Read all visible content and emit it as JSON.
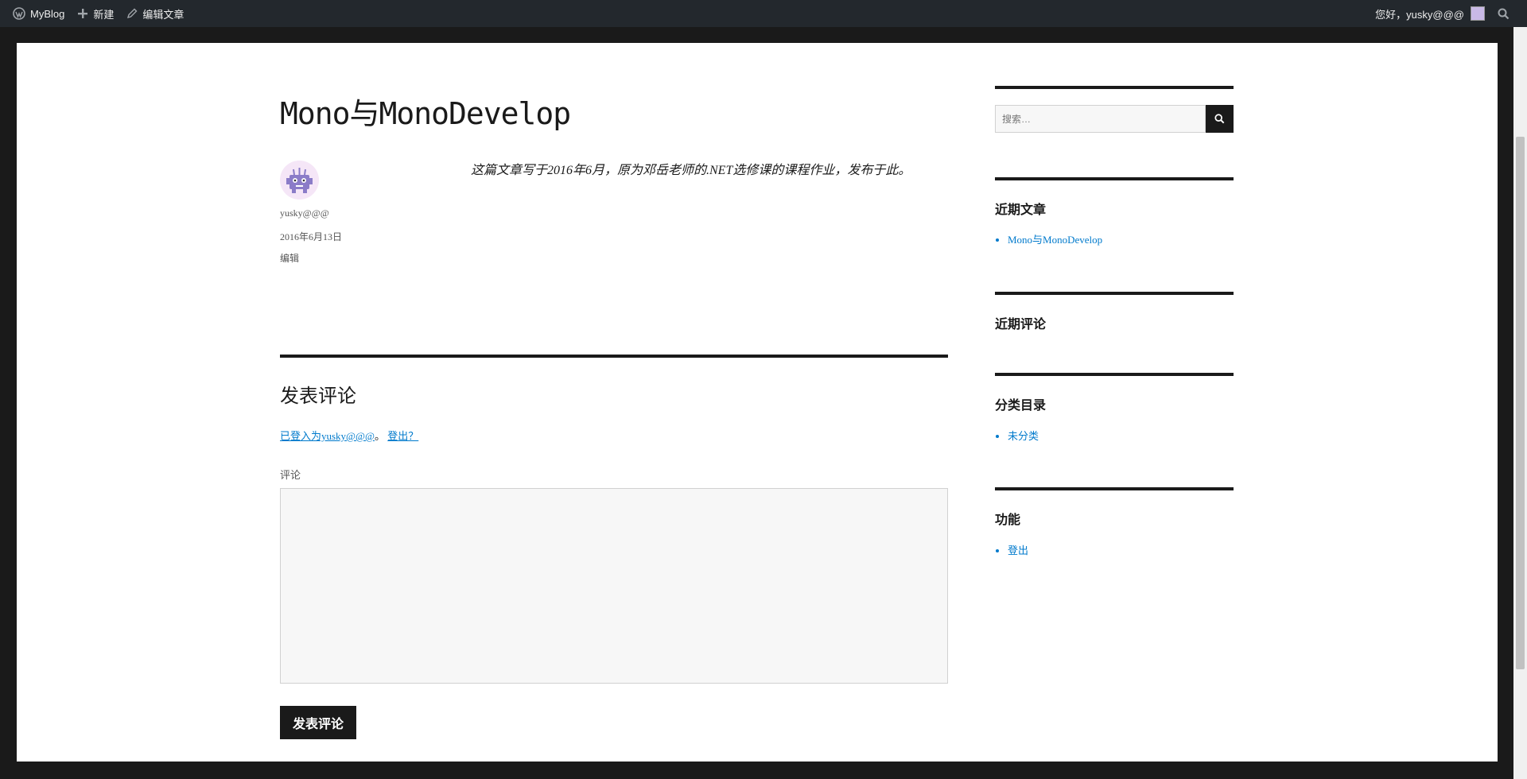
{
  "adminbar": {
    "site_name": "MyBlog",
    "new_label": "新建",
    "edit_label": "编辑文章",
    "greeting": "您好，yusky@@@"
  },
  "post": {
    "title": "Mono与MonoDevelop",
    "author": "yusky@@@",
    "date": "2016年6月13日",
    "edit_link": "编辑",
    "content": "这篇文章写于2016年6月，原为邓岳老师的.NET选修课的课程作业，发布于此。"
  },
  "comments": {
    "title": "发表评论",
    "logged_in_text": "已登入为yusky@@@",
    "separator": "。",
    "logout_text": "登出？",
    "comment_label": "评论",
    "textarea_value": "",
    "submit_label": "发表评论"
  },
  "sidebar": {
    "search_placeholder": "搜索…",
    "recent_posts": {
      "title": "近期文章",
      "items": [
        "Mono与MonoDevelop"
      ]
    },
    "recent_comments": {
      "title": "近期评论"
    },
    "categories": {
      "title": "分类目录",
      "items": [
        "未分类"
      ]
    },
    "meta": {
      "title": "功能",
      "items": [
        "登出"
      ]
    }
  },
  "colors": {
    "link": "#007acc",
    "dark": "#1a1a1a",
    "adminbar": "#23282d"
  },
  "icons": [
    "wordpress-icon",
    "plus-icon",
    "pencil-icon",
    "search-icon"
  ]
}
